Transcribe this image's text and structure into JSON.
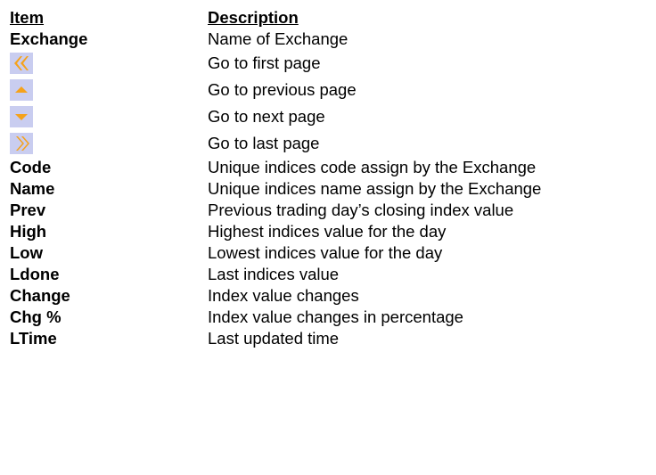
{
  "header": {
    "item_label": "Item",
    "description_label": "Description"
  },
  "rows": [
    {
      "item": "Exchange",
      "description": "Name of Exchange"
    },
    {
      "icon": "first-page-icon",
      "description": "Go to first page"
    },
    {
      "icon": "previous-page-icon",
      "description": "Go to previous page"
    },
    {
      "icon": "next-page-icon",
      "description": "Go to next page"
    },
    {
      "icon": "last-page-icon",
      "description": "Go to last page"
    },
    {
      "item": "Code",
      "description": "Unique indices code assign by the Exchange"
    },
    {
      "item": "Name",
      "description": "Unique indices name assign by the Exchange"
    },
    {
      "item": "Prev",
      "description": "Previous trading day’s closing index value"
    },
    {
      "item": "High",
      "description": "Highest indices value for the day"
    },
    {
      "item": "Low",
      "description": "Lowest indices value for the day"
    },
    {
      "item": "Ldone",
      "description": "Last indices value"
    },
    {
      "item": "Change",
      "description": "Index value changes"
    },
    {
      "item": "Chg %",
      "description": "Index value changes in percentage"
    },
    {
      "item": "LTime",
      "description": "Last updated time"
    }
  ],
  "colors": {
    "icon_background": "#c9cdf0",
    "icon_arrow": "#f5a21b"
  }
}
